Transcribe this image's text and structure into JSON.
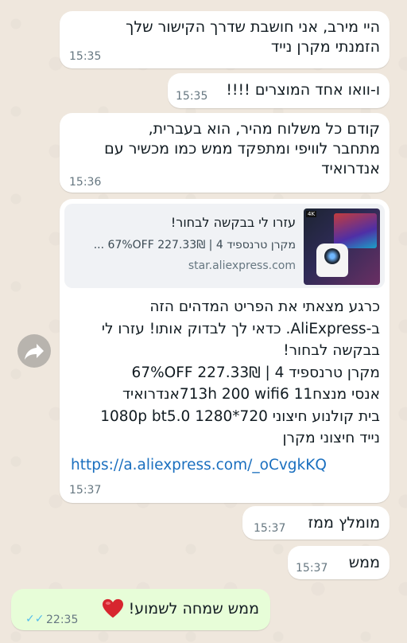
{
  "messages": [
    {
      "text": "היי מירב, אני חושבת שדרך הקישור שלך\nהזמנתי מקרן נייד",
      "time": "15:35"
    },
    {
      "text": "ו-וואו אחד המוצרים !!!!",
      "time": "15:35"
    },
    {
      "text": "קודם כל משלוח מהיר, הוא בעברית,\nמתחבר לוויפי ומתפקד ממש כמו מכשיר עם\nאנדרואיד",
      "time": "15:36"
    },
    {
      "preview": {
        "title": "עזרו לי בבקשה לבחור!",
        "desc": "מקרן טרנספיד 4 | 67%OFF 227.33₪ ...",
        "domain": "star.aliexpress.com",
        "thumb_badge": "4K"
      },
      "text": "כרגע מצאתי את הפריט המדהים הזה\nב-AliExpress. כדאי לך לבדוק אותו! עזרו לי\nבבקשה לבחור!\nמקרן טרנספיד 4 | 67%OFF  227.33₪\nאנסי מנצח713h  200 wifi6 11אנדרואיד\nבית קולנוע חיצוני 720*1280 1080p bt5.0\nנייד חיצוני מקרן",
      "link": "https://a.aliexpress.com/_oCvgkKQ",
      "time": "15:37"
    },
    {
      "text": "מומלץ ממז",
      "time": "15:37"
    },
    {
      "text": "ממש",
      "time": "15:37"
    },
    {
      "text": "ממש שמחה לשמוע!",
      "time": "22:35",
      "ticks": "✓✓",
      "emoji": "heart"
    }
  ],
  "forward_icon": "share-arrow-icon",
  "colors": {
    "incoming_bubble": "#ffffff",
    "outgoing_bubble": "#e7fdd8",
    "link": "#1a6fbf",
    "read_ticks": "#53bdeb",
    "heart": "#d7262f"
  }
}
